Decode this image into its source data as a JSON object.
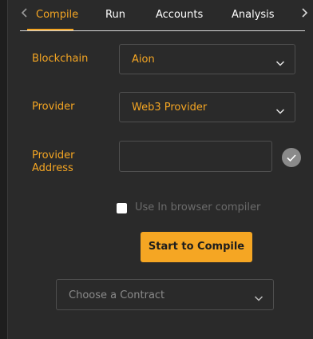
{
  "tabs": {
    "prev_icon": "chevron-left-icon",
    "next_icon": "chevron-right-icon",
    "items": [
      {
        "label": "Compile",
        "active": true
      },
      {
        "label": "Run",
        "active": false
      },
      {
        "label": "Accounts",
        "active": false
      },
      {
        "label": "Analysis",
        "active": false
      }
    ]
  },
  "form": {
    "blockchain": {
      "label": "Blockchain",
      "value": "Aion"
    },
    "provider": {
      "label": "Provider",
      "value": "Web3 Provider"
    },
    "provider_address": {
      "label_line1": "Provider",
      "label_line2": "Address",
      "value": ""
    },
    "browser_compiler": {
      "label": "Use In browser compiler",
      "checked": false
    },
    "compile_button": "Start to Compile",
    "contract_select": {
      "placeholder": "Choose a Contract"
    }
  },
  "colors": {
    "accent": "#f5a623",
    "background": "#2a2a2a",
    "border": "#4f4f4f"
  }
}
